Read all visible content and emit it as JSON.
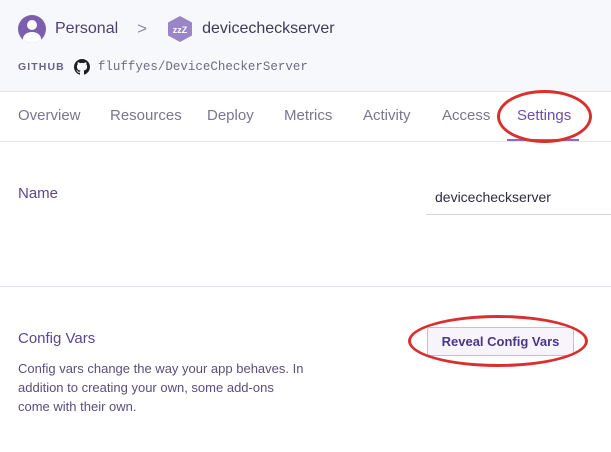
{
  "breadcrumb": {
    "account": "Personal",
    "separator": ">",
    "app": "devicecheckserver",
    "app_icon_text": "zzZ"
  },
  "github": {
    "label": "GITHUB",
    "repo": "fluffyes/DeviceCheckerServer"
  },
  "tabs": [
    {
      "label": "Overview"
    },
    {
      "label": "Resources"
    },
    {
      "label": "Deploy"
    },
    {
      "label": "Metrics"
    },
    {
      "label": "Activity"
    },
    {
      "label": "Access"
    },
    {
      "label": "Settings",
      "active": true
    }
  ],
  "name_section": {
    "label": "Name",
    "value": "devicecheckserver"
  },
  "config_vars": {
    "title": "Config Vars",
    "description": "Config vars change the way your app behaves. In addition to creating your own, some add-ons come with their own.",
    "button_label": "Reveal Config Vars"
  },
  "annotations": {
    "color": "#d8302f",
    "highlights": [
      "Settings",
      "Reveal Config Vars"
    ]
  },
  "colors": {
    "accent": "#6f4ea6",
    "avatar": "#7b5fae",
    "app_icon": "#9a85c6"
  }
}
